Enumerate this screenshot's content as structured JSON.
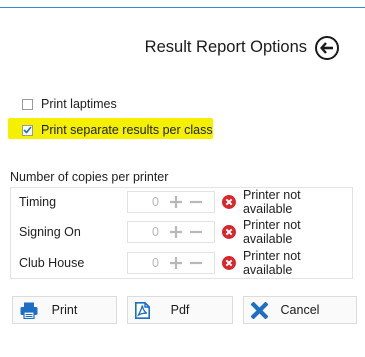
{
  "header": {
    "title": "Result Report Options",
    "back_icon": "arrow-left-icon"
  },
  "options": {
    "print_laptimes": {
      "label": "Print laptimes",
      "checked": false
    },
    "print_separate": {
      "label": "Print separate results per class",
      "checked": true,
      "highlight_color": "#f4f000"
    }
  },
  "copies": {
    "section_label": "Number of copies per printer",
    "printers": [
      {
        "name": "Timing",
        "count": "0",
        "status": "Printer not available"
      },
      {
        "name": "Signing On",
        "count": "0",
        "status": "Printer not available"
      },
      {
        "name": "Club House",
        "count": "0",
        "status": "Printer not available"
      }
    ]
  },
  "buttons": {
    "print": {
      "label": "Print",
      "icon": "printer-icon"
    },
    "pdf": {
      "label": "Pdf",
      "icon": "pdf-icon"
    },
    "cancel": {
      "label": "Cancel",
      "icon": "close-icon"
    }
  },
  "colors": {
    "accent": "#2f8fd8",
    "error": "#d9262c",
    "check": "#1c6fc4"
  }
}
